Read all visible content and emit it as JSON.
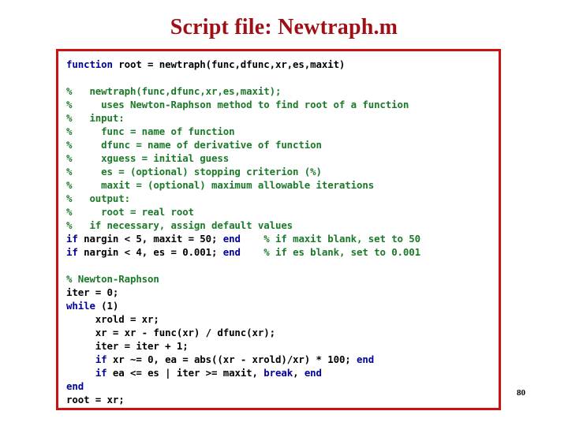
{
  "slide": {
    "title": "Script file: Newtraph.m",
    "title_color": "#9e1016",
    "page_number": "80",
    "background_color": "#ffffff"
  },
  "code_box": {
    "border_color": "#cc1111",
    "background_color": "#ffffff",
    "language": "MATLAB",
    "syntax_colors": {
      "keyword": "#00009b",
      "comment": "#1a7a28",
      "plain": "#000000"
    },
    "lines": [
      {
        "segments": [
          {
            "t": "function",
            "c": "kw"
          },
          {
            "t": " root = newtraph(func,dfunc,xr,es,maxit)",
            "c": "plain"
          }
        ]
      },
      {
        "segments": []
      },
      {
        "segments": [
          {
            "t": "%   newtraph(func,dfunc,xr,es,maxit);",
            "c": "comment"
          }
        ]
      },
      {
        "segments": [
          {
            "t": "%     uses Newton-Raphson method to find root of a function",
            "c": "comment"
          }
        ]
      },
      {
        "segments": [
          {
            "t": "%   input:",
            "c": "comment"
          }
        ]
      },
      {
        "segments": [
          {
            "t": "%     func = name of function",
            "c": "comment"
          }
        ]
      },
      {
        "segments": [
          {
            "t": "%     dfunc = name of derivative of function",
            "c": "comment"
          }
        ]
      },
      {
        "segments": [
          {
            "t": "%     xguess = initial guess",
            "c": "comment"
          }
        ]
      },
      {
        "segments": [
          {
            "t": "%     es = (optional) stopping criterion (%)",
            "c": "comment"
          }
        ]
      },
      {
        "segments": [
          {
            "t": "%     maxit = (optional) maximum allowable iterations",
            "c": "comment"
          }
        ]
      },
      {
        "segments": [
          {
            "t": "%   output:",
            "c": "comment"
          }
        ]
      },
      {
        "segments": [
          {
            "t": "%     root = real root",
            "c": "comment"
          }
        ]
      },
      {
        "segments": [
          {
            "t": "%   if necessary, assign default values",
            "c": "comment"
          }
        ]
      },
      {
        "segments": [
          {
            "t": "if",
            "c": "kw"
          },
          {
            "t": " nargin < 5, maxit = 50; ",
            "c": "plain"
          },
          {
            "t": "end",
            "c": "kw"
          },
          {
            "t": "    ",
            "c": "plain"
          },
          {
            "t": "% if maxit blank, set to 50",
            "c": "comment"
          }
        ]
      },
      {
        "segments": [
          {
            "t": "if",
            "c": "kw"
          },
          {
            "t": " nargin < 4, es = 0.001; ",
            "c": "plain"
          },
          {
            "t": "end",
            "c": "kw"
          },
          {
            "t": "    ",
            "c": "plain"
          },
          {
            "t": "% if es blank, set to 0.001",
            "c": "comment"
          }
        ]
      },
      {
        "segments": []
      },
      {
        "segments": [
          {
            "t": "% Newton-Raphson",
            "c": "comment"
          }
        ]
      },
      {
        "segments": [
          {
            "t": "iter = 0;",
            "c": "plain"
          }
        ]
      },
      {
        "segments": [
          {
            "t": "while",
            "c": "kw"
          },
          {
            "t": " (1)",
            "c": "plain"
          }
        ]
      },
      {
        "segments": [
          {
            "t": "     xrold = xr;",
            "c": "plain"
          }
        ]
      },
      {
        "segments": [
          {
            "t": "     xr = xr - func(xr) / dfunc(xr);",
            "c": "plain"
          }
        ]
      },
      {
        "segments": [
          {
            "t": "     iter = iter + 1;",
            "c": "plain"
          }
        ]
      },
      {
        "segments": [
          {
            "t": "     ",
            "c": "plain"
          },
          {
            "t": "if",
            "c": "kw"
          },
          {
            "t": " xr ~= 0, ea = abs((xr - xrold)/xr) * 100; ",
            "c": "plain"
          },
          {
            "t": "end",
            "c": "kw"
          }
        ]
      },
      {
        "segments": [
          {
            "t": "     ",
            "c": "plain"
          },
          {
            "t": "if",
            "c": "kw"
          },
          {
            "t": " ea <= es | iter >= maxit, ",
            "c": "plain"
          },
          {
            "t": "break",
            "c": "kw"
          },
          {
            "t": ", ",
            "c": "plain"
          },
          {
            "t": "end",
            "c": "kw"
          }
        ]
      },
      {
        "segments": [
          {
            "t": "end",
            "c": "kw"
          }
        ]
      },
      {
        "segments": [
          {
            "t": "root = xr;",
            "c": "plain"
          }
        ]
      }
    ]
  }
}
